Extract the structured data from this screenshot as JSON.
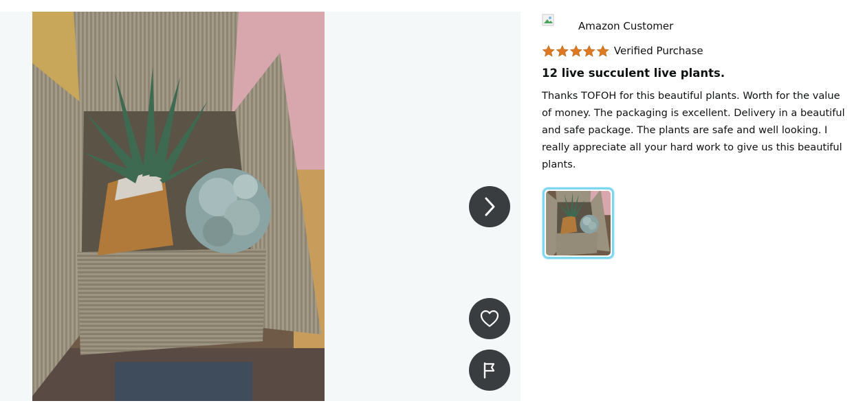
{
  "media": {
    "image_alt": "Customer photo of succulent plants in a cardboard box",
    "next_button": "Next image",
    "like_button": "Like",
    "report_button": "Report"
  },
  "review": {
    "reviewer_name": "Amazon Customer",
    "rating": 5,
    "rating_max": 5,
    "verified_label": "Verified Purchase",
    "title": "12 live succulent live plants.",
    "body": "Thanks TOFOH for this beautiful plants. Worth for the value of money. The packaging is excellent. Delivery in a beautiful and safe package. The plants are safe and well looking. I really appreciate all your hard work to give us this beautiful plants."
  },
  "colors": {
    "star": "#de7921",
    "nav_button_bg": "#3a3d3f",
    "thumb_border": "#7fd6f0",
    "viewer_bg": "#f5f8f9"
  },
  "icons": {
    "next": "chevron-right-icon",
    "like": "heart-icon",
    "report": "flag-icon",
    "avatar": "avatar-icon"
  }
}
